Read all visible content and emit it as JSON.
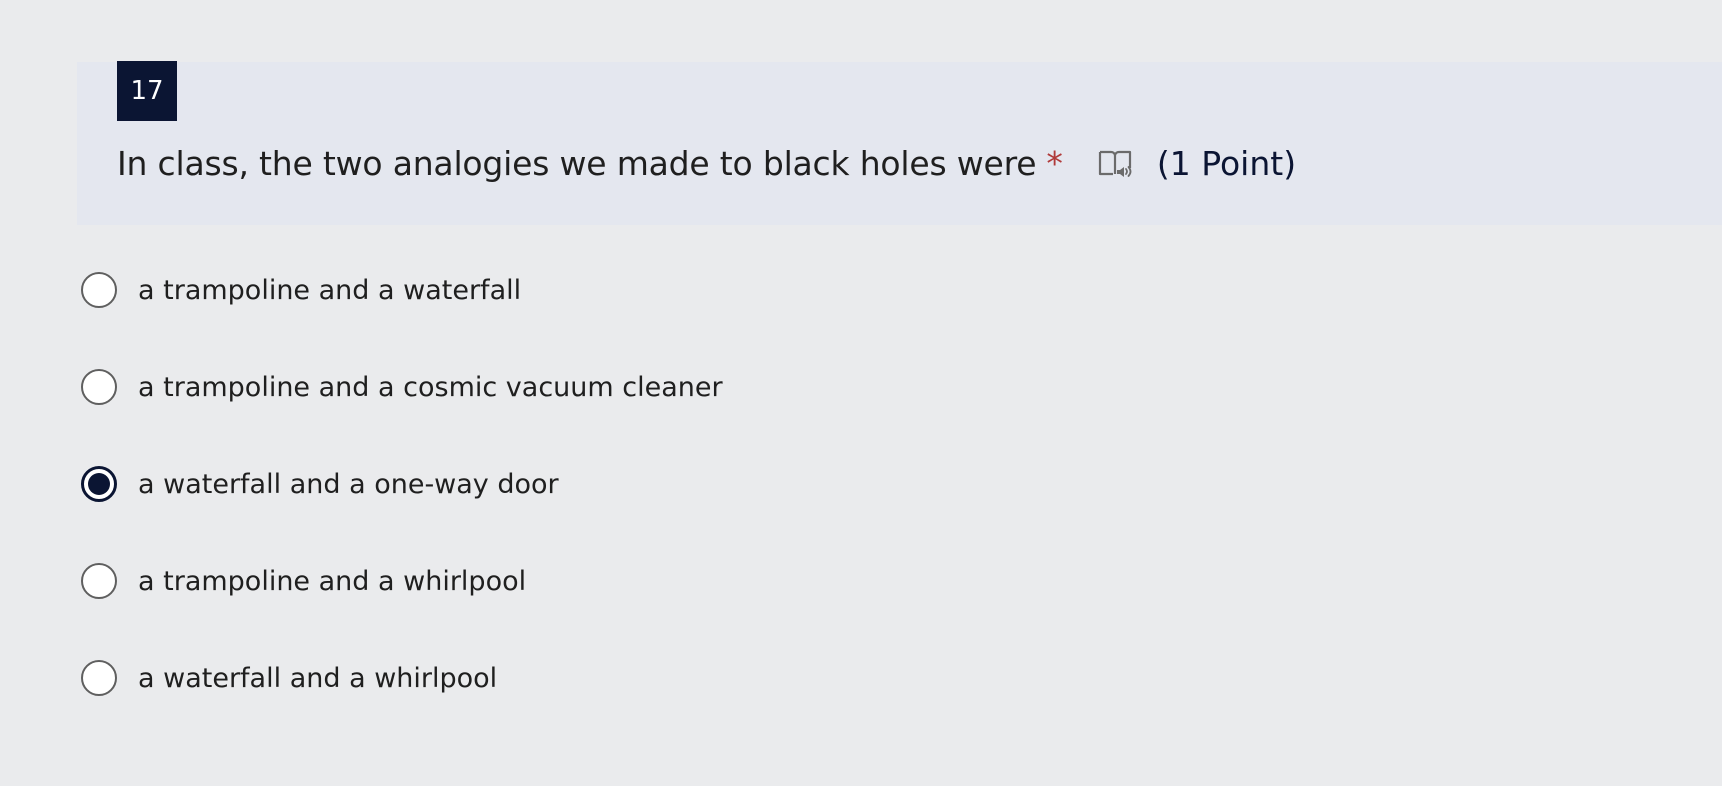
{
  "question": {
    "number": "17",
    "text": "In class, the two analogies we made to black holes were",
    "required_mark": "*",
    "points": "(1 Point)",
    "reader_icon": "immersive-reader-icon"
  },
  "options": [
    {
      "label": "a trampoline and a waterfall",
      "selected": false
    },
    {
      "label": "a trampoline and a cosmic vacuum cleaner",
      "selected": false
    },
    {
      "label": "a waterfall and a one-way door",
      "selected": true
    },
    {
      "label": "a trampoline and a whirlpool",
      "selected": false
    },
    {
      "label": "a waterfall and a whirlpool",
      "selected": false
    }
  ],
  "colors": {
    "accent": "#0b1533",
    "required": "#b03a3a",
    "header_bg": "#e4e7ef",
    "page_bg": "#eaebed"
  }
}
